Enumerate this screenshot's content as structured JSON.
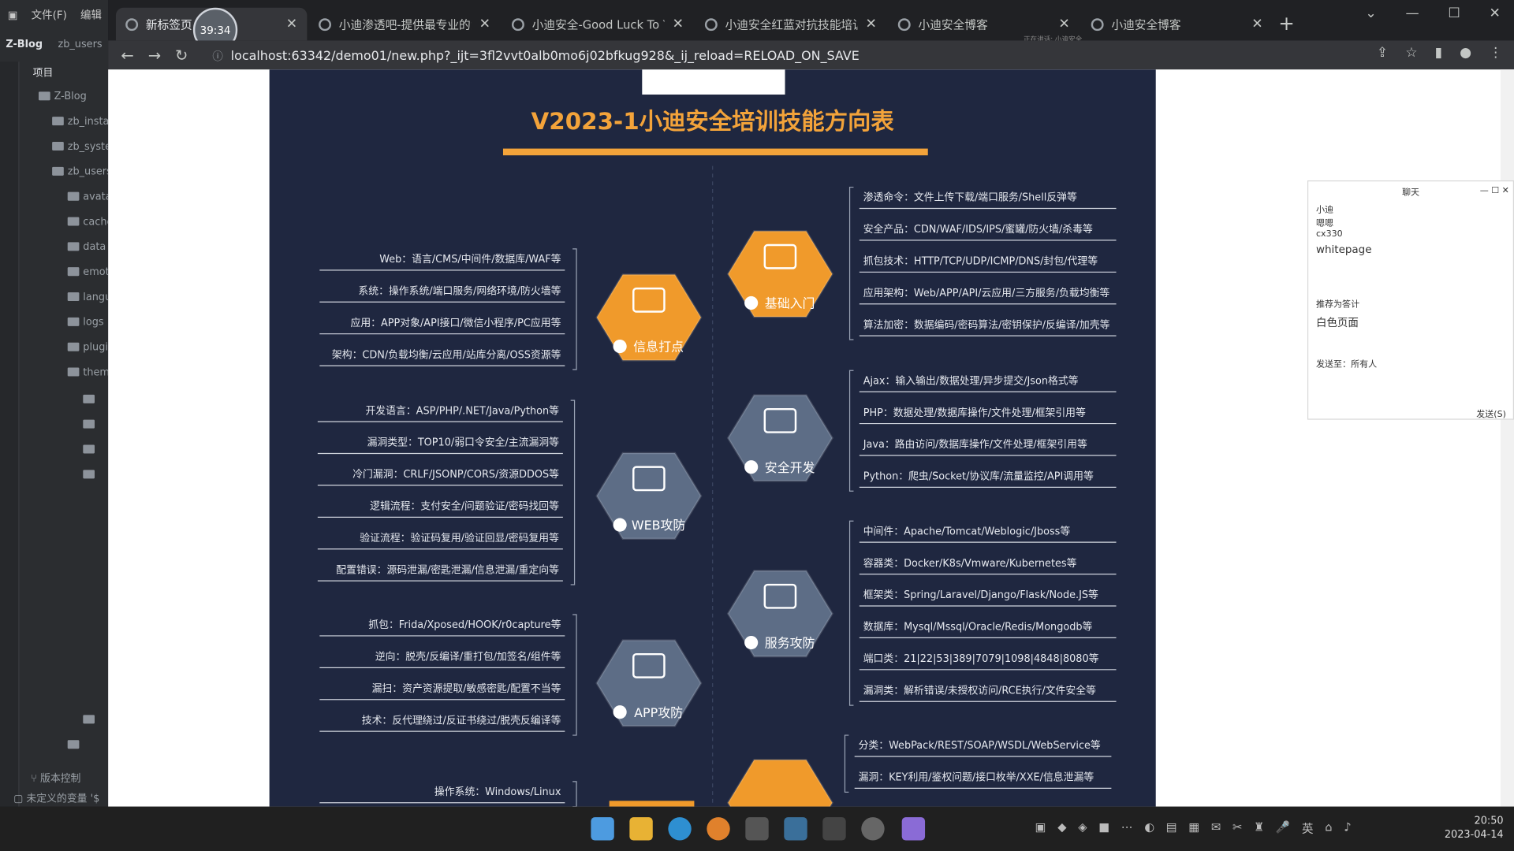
{
  "ide": {
    "menu": [
      "文件(F)",
      "编辑"
    ],
    "project_label": "Z-Blog",
    "project_path": "zb_users",
    "panel_title": "项目",
    "tree": [
      "Z-Blog",
      "zb_install",
      "zb_system",
      "zb_users",
      "avatar",
      "cache",
      "data",
      "emotion",
      "language",
      "logs",
      "plugin",
      "theme"
    ],
    "bottom_items": [
      "版本控制",
      "未定义的变量 '$"
    ]
  },
  "browser": {
    "tabs": [
      {
        "title": "新标签页"
      },
      {
        "title": "小迪渗透吧-提供最专业的渗"
      },
      {
        "title": "小迪安全-Good Luck To Yo"
      },
      {
        "title": "小迪安全红蓝对抗技能培训"
      },
      {
        "title": "小迪安全博客"
      },
      {
        "title": "小迪安全博客"
      }
    ],
    "timer": "39:34",
    "url": "localhost:63342/demo01/new.php?_ijt=3fl2vvt0alb0mo6j02bfkug928&_ij_reload=RELOAD_ON_SAVE",
    "meeting": "正在讲话: 小迪安全"
  },
  "poster": {
    "title": "V2023-1小迪安全培训技能方向表",
    "nodes": [
      {
        "label": "基础入门",
        "color": "#f09a2b"
      },
      {
        "label": "信息打点",
        "color": "#f09a2b"
      },
      {
        "label": "安全开发",
        "color": "#5d6d86"
      },
      {
        "label": "WEB攻防",
        "color": "#5d6d86"
      },
      {
        "label": "服务攻防",
        "color": "#5d6d86"
      },
      {
        "label": "APP攻防",
        "color": "#5d6d86"
      }
    ],
    "groups": {
      "jichu": [
        "渗透命令：文件上传下载/端口服务/Shell反弹等",
        "安全产品：CDN/WAF/IDS/IPS/蜜罐/防火墙/杀毒等",
        "抓包技术：HTTP/TCP/UDP/ICMP/DNS/封包/代理等",
        "应用架构：Web/APP/API/云应用/三方服务/负载均衡等",
        "算法加密：数据编码/密码算法/密钥保护/反编译/加壳等"
      ],
      "xinxi": [
        "Web：语言/CMS/中间件/数据库/WAF等",
        "系统：操作系统/端口服务/网络环境/防火墙等",
        "应用：APP对象/API接口/微信小程序/PC应用等",
        "架构：CDN/负载均衡/云应用/站库分离/OSS资源等"
      ],
      "kaifa": [
        "Ajax：输入输出/数据处理/异步提交/Json格式等",
        "PHP：数据处理/数据库操作/文件处理/框架引用等",
        "Java：路由访问/数据库操作/文件处理/框架引用等",
        "Python：爬虫/Socket/协议库/流量监控/API调用等"
      ],
      "web": [
        "开发语言：ASP/PHP/.NET/Java/Python等",
        "漏洞类型：TOP10/弱口令安全/主流漏洞等",
        "冷门漏洞：CRLF/JSONP/CORS/资源DDOS等",
        "逻辑流程：支付安全/问题验证/密码找回等",
        "验证流程：验证码复用/验证回显/密码复用等",
        "配置错误：源码泄漏/密匙泄漏/信息泄漏/重定向等"
      ],
      "fuwu": [
        "中间件：Apache/Tomcat/Weblogic/Jboss等",
        "容器类：Docker/K8s/Vmware/Kubernetes等",
        "框架类：Spring/Laravel/Django/Flask/Node.JS等",
        "数据库：Mysql/Mssql/Oracle/Redis/Mongodb等",
        "端口类：21|22|53|389|7079|1098|4848|8080等",
        "漏洞类：解析错误/未授权访问/RCE执行/文件安全等"
      ],
      "app": [
        "抓包：Frida/Xposed/HOOK/r0capture等",
        "逆向：脱壳/反编译/重打包/加签名/组件等",
        "漏扫：资产资源提取/敏感密匙/配置不当等",
        "技术：反代理绕过/反证书绕过/脱壳反编译等"
      ],
      "next_left": [
        "操作系统：Windows/Linux"
      ],
      "next_right": [
        "分类：WebPack/REST/SOAP/WSDL/WebService等",
        "漏洞：KEY利用/鉴权问题/接口枚举/XXE/信息泄漏等"
      ]
    }
  },
  "chat": {
    "title": "聊天",
    "lines": [
      "小迪",
      "嗯嗯",
      "cx330",
      "whitepage",
      "推荐为答计",
      "白色页面",
      "发送至：",
      "所有人",
      "发送(S)"
    ]
  },
  "taskbar": {
    "time": "20:50",
    "date": "2023-04-14",
    "ime": "英"
  }
}
